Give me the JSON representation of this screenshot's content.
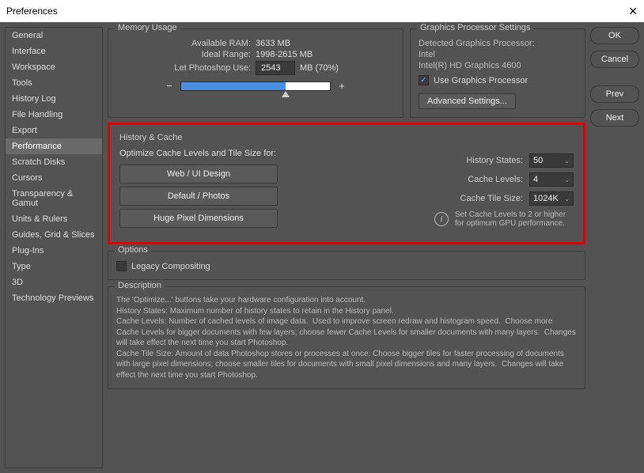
{
  "window": {
    "title": "Preferences"
  },
  "sidebar": {
    "items": [
      "General",
      "Interface",
      "Workspace",
      "Tools",
      "History Log",
      "File Handling",
      "Export",
      "Performance",
      "Scratch Disks",
      "Cursors",
      "Transparency & Gamut",
      "Units & Rulers",
      "Guides, Grid & Slices",
      "Plug-Ins",
      "Type",
      "3D",
      "Technology Previews"
    ],
    "active_index": 7
  },
  "memory": {
    "legend": "Memory Usage",
    "available_label": "Available RAM:",
    "available_value": "3633 MB",
    "ideal_label": "Ideal Range:",
    "ideal_value": "1998-2615 MB",
    "let_use_label": "Let Photoshop Use:",
    "let_use_value": "2543",
    "let_use_unit": "MB (70%)",
    "slider_percent": 70
  },
  "graphics": {
    "legend": "Graphics Processor Settings",
    "detected_label": "Detected Graphics Processor:",
    "vendor": "Intel",
    "model": "Intel(R) HD Graphics 4600",
    "use_gp_label": "Use Graphics Processor",
    "use_gp_checked": true,
    "advanced_btn": "Advanced Settings..."
  },
  "history": {
    "legend": "History & Cache",
    "optimize_label": "Optimize Cache Levels and Tile Size for:",
    "btn_web": "Web / UI Design",
    "btn_default": "Default / Photos",
    "btn_huge": "Huge Pixel Dimensions",
    "states_label": "History States:",
    "states_value": "50",
    "cache_levels_label": "Cache Levels:",
    "cache_levels_value": "4",
    "tile_size_label": "Cache Tile Size:",
    "tile_size_value": "1024K",
    "info_text": "Set Cache Levels to 2 or higher for optimum GPU performance."
  },
  "options": {
    "legend": "Options",
    "legacy_label": "Legacy Compositing",
    "legacy_checked": false
  },
  "description": {
    "legend": "Description",
    "text": "The 'Optimize...' buttons take your hardware configuration into account.\nHistory States: Maximum number of history states to retain in the History panel.\nCache Levels: Number of cached levels of image data.  Used to improve screen redraw and histogram speed.  Choose more Cache Levels for bigger documents with few layers; choose fewer Cache Levels for smaller documents with many layers.  Changes will take effect the next time you start Photoshop.\nCache Tile Size: Amount of data Photoshop stores or processes at once. Choose bigger tiles for faster processing of documents with large pixel dimensions; choose smaller tiles for documents with small pixel dimensions and many layers.  Changes will take effect the next time you start Photoshop."
  },
  "buttons": {
    "ok": "OK",
    "cancel": "Cancel",
    "prev": "Prev",
    "next": "Next"
  }
}
